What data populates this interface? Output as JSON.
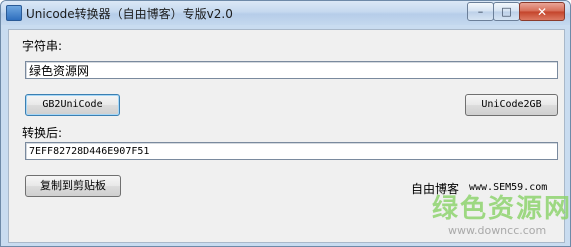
{
  "window": {
    "title": "Unicode转换器（自由博客）专版v2.0",
    "controls": {
      "minimize": "–",
      "maximize": "□",
      "close": "✕"
    }
  },
  "form": {
    "input_label": "字符串:",
    "input_value": "绿色资源网",
    "gb2unicode_button": "GB2UniCode",
    "unicode2gb_button": "UniCode2GB",
    "output_label": "转换后:",
    "output_value": "7EFF82728D446E907F51",
    "copy_button": "复制到剪贴板",
    "site_name": "自由博客",
    "site_url": "www.SEM59.com"
  },
  "watermark": {
    "name": "绿色资源网",
    "url": "www.downcc.com"
  },
  "icons": {
    "app": "app-icon",
    "minimize": "minimize-icon",
    "maximize": "maximize-icon",
    "close": "close-icon"
  }
}
